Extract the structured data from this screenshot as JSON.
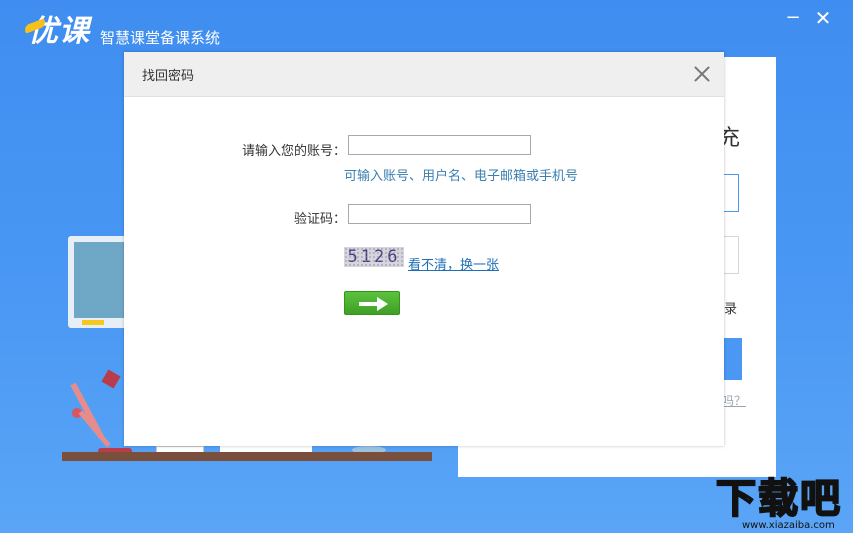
{
  "app": {
    "logo_text": "优课",
    "subtitle": "智慧课堂备课系统",
    "window_min": "−",
    "window_close": "✕"
  },
  "login_card": {
    "title_fragment": "充",
    "link_fragment": "录",
    "forgot_fragment": "吗？"
  },
  "dialog": {
    "title": "找回密码",
    "account_label": "请输入您的账号：",
    "account_value": "",
    "account_hint": "可输入账号、用户名、电子邮箱或手机号",
    "code_label": "验证码：",
    "code_value": "",
    "captcha_text": "5126",
    "refresh_link": "看不清，换一张",
    "next_icon": "arrow-right-icon"
  },
  "watermark": {
    "text": "下载吧",
    "url": "www.xiazaiba.com"
  }
}
